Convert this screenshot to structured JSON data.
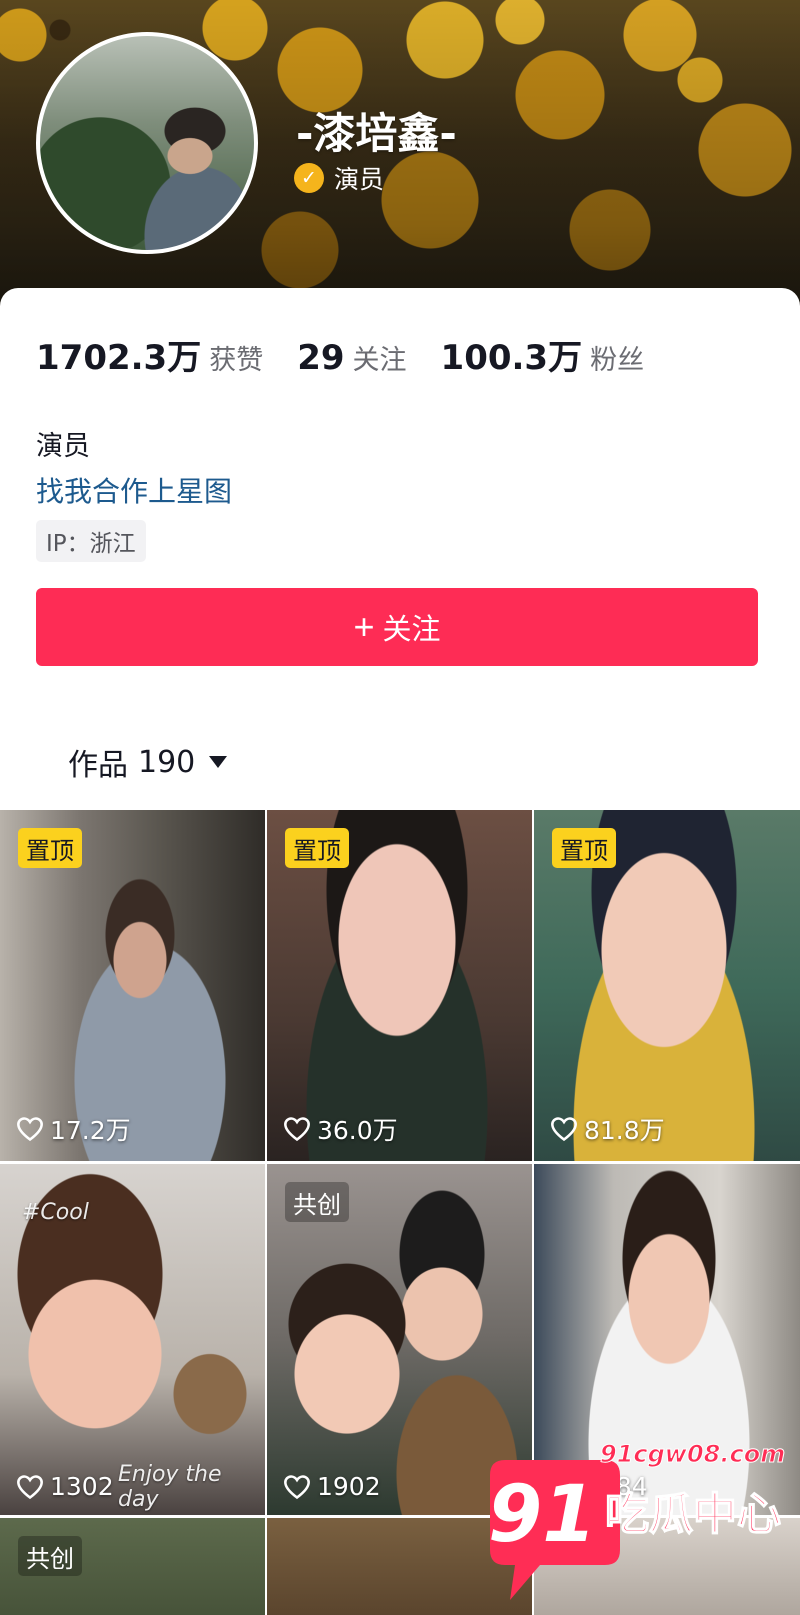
{
  "profile": {
    "name": "-漆培鑫-",
    "verified_label": "演员",
    "bio": "演员",
    "bio_link": "找我合作上星图",
    "ip_location": "IP：浙江"
  },
  "stats": [
    {
      "value": "1702.3万",
      "label": "获赞"
    },
    {
      "value": "29",
      "label": "关注"
    },
    {
      "value": "100.3万",
      "label": "粉丝"
    }
  ],
  "follow_button": {
    "icon": "plus-icon",
    "plus": "+",
    "label": "关注"
  },
  "works_tab": {
    "label": "作品",
    "count": "190"
  },
  "videos": [
    {
      "badge": "置顶",
      "badge_type": "pinned",
      "likes": "17.2万"
    },
    {
      "badge": "置顶",
      "badge_type": "pinned",
      "likes": "36.0万"
    },
    {
      "badge": "置顶",
      "badge_type": "pinned",
      "likes": "81.8万"
    },
    {
      "badge": "",
      "badge_type": "",
      "likes": "1302",
      "overlay_top": "#Cool",
      "overlay_bottom": "Enjoy the day"
    },
    {
      "badge": "共创",
      "badge_type": "collab",
      "likes": "1902"
    },
    {
      "badge": "",
      "badge_type": "",
      "likes": "4584"
    },
    {
      "badge": "共创",
      "badge_type": "collab",
      "likes": ""
    },
    {
      "badge": "",
      "badge_type": "",
      "likes": ""
    },
    {
      "badge": "",
      "badge_type": "",
      "likes": ""
    }
  ],
  "watermark": {
    "number": "91",
    "domain": "91cgw08.com",
    "text": "吃瓜中心"
  },
  "colors": {
    "accent": "#fe2c55",
    "link": "#1d5a8e",
    "pinned_badge": "#fbd11e",
    "verified": "#f5b41c"
  }
}
